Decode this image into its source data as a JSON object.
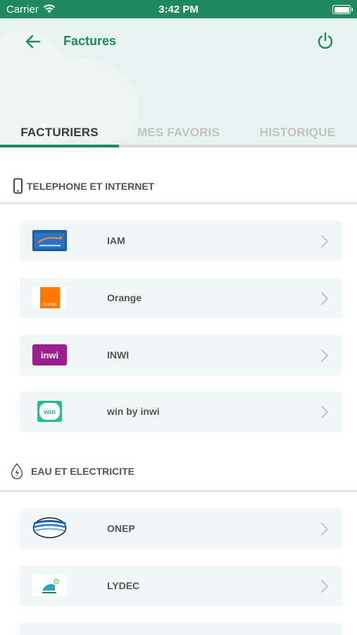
{
  "status_bar": {
    "carrier": "Carrier",
    "time": "3:42 PM"
  },
  "header": {
    "title": "Factures",
    "back_icon": "arrow-left-icon",
    "power_icon": "power-icon"
  },
  "tabs": [
    {
      "label": "FACTURIERS",
      "active": true
    },
    {
      "label": "MES FAVORIS",
      "active": false
    },
    {
      "label": "HISTORIQUE",
      "active": false
    }
  ],
  "sections": [
    {
      "label": "TELEPHONE ET INTERNET",
      "icon": "smartphone-icon",
      "billers": [
        {
          "name": "IAM",
          "logo": "iam-logo"
        },
        {
          "name": "Orange",
          "logo": "orange-logo",
          "logo_text": "orange"
        },
        {
          "name": "INWI",
          "logo": "inwi-logo",
          "logo_text": "inwi"
        },
        {
          "name": "win by inwi",
          "logo": "win-logo",
          "logo_text": "win"
        }
      ]
    },
    {
      "label": "EAU ET ELECTRICITE",
      "icon": "water-electricity-icon",
      "billers": [
        {
          "name": "ONEP",
          "logo": "onep-logo"
        },
        {
          "name": "LYDEC",
          "logo": "lydec-logo"
        }
      ]
    }
  ],
  "colors": {
    "brand_green": "#1f8a62",
    "header_bg": "#e8f3f1",
    "card_bg": "#f1f7f6"
  }
}
